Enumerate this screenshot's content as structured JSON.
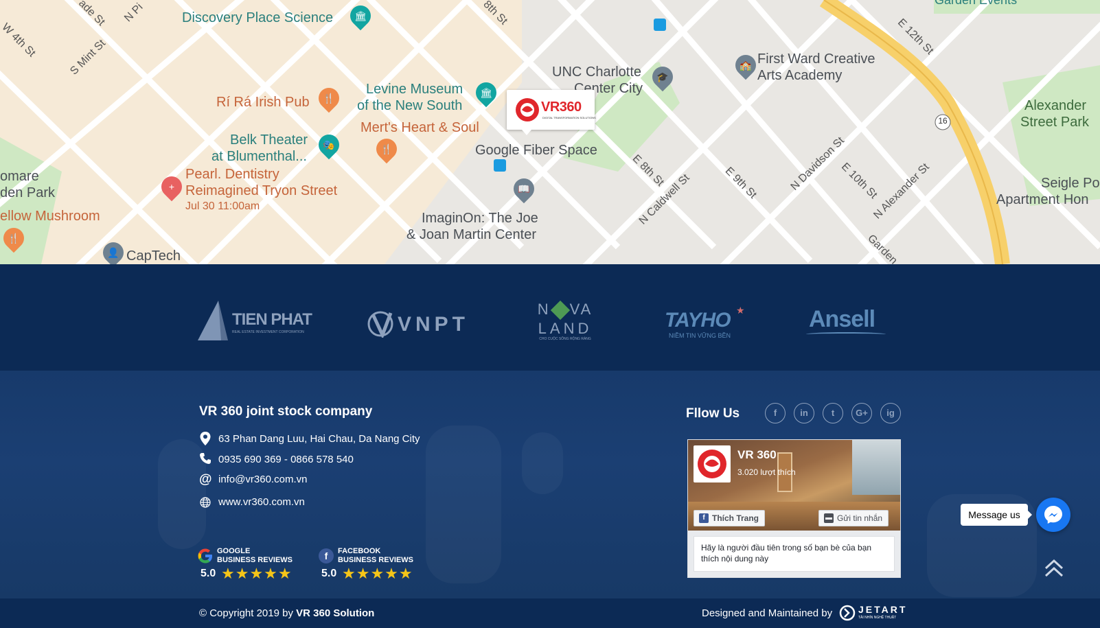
{
  "map": {
    "labels": {
      "discovery": "Discovery Place Science",
      "rira": "Rí Rá Irish Pub",
      "levine1": "Levine Museum",
      "levine2": "of the New South",
      "merts": "Mert's Heart & Soul",
      "unc1": "UNC Charlotte",
      "unc2": "Center City",
      "firstward1": "First Ward Creative",
      "firstward2": "Arts Academy",
      "alexander1": "Alexander",
      "alexander2": "Street Park",
      "belk1": "Belk Theater",
      "belk2": "at Blumenthal...",
      "pearl1": "Pearl. Dentistry",
      "pearl2": "Reimagined Tryon Street",
      "pearl_date": "Jul 30 11:00am",
      "fiber": "Google Fiber Space",
      "imaginon1": "ImaginOn: The Joe",
      "imaginon2": "& Joan Martin Center",
      "captech": "CapTech",
      "yellow": "ellow Mushroom",
      "romare1": "omare",
      "romare2": "den Park",
      "seigle1": "Seigle Po",
      "seigle2": "Apartment Hon",
      "garden_events": "Garden Events",
      "route16": "16"
    },
    "streets": {
      "w4th": "W 4th St",
      "smint": "S Mint St",
      "ade": "ade St",
      "npi": "N Pi",
      "e8th_top": "8th St",
      "e12th": "E 12th St",
      "e8th": "E 8th St",
      "ncaldwell": "N Caldwell St",
      "e9th": "E 9th St",
      "ndavidson": "N Davidson St",
      "e10th": "E 10th St",
      "nalexander": "N Alexander St",
      "garden": "Garden"
    },
    "marker_brand": "VR360",
    "marker_tagline": "DIGITAL TRANSFORMATION SOLUTIONS"
  },
  "partners": [
    {
      "name": "TIEN PHAT",
      "sub": "REAL ESTATE INVESTMENT CORPORATION"
    },
    {
      "name": "VNPT"
    },
    {
      "name1": "N",
      "name2": "VA",
      "name3": "LAND",
      "sub": "CHO CUỘC SỐNG RỘNG RÀNG"
    },
    {
      "name": "TAYHO",
      "sub": "NIỀM TIN VỮNG BỀN"
    },
    {
      "name": "Ansell"
    }
  ],
  "company": {
    "title": "VR 360 joint stock company",
    "address": "63 Phan Dang Luu, Hai Chau, Da Nang City",
    "phone": "0935 690 369 - 0866 578 540",
    "email": "info@vr360.com.vn",
    "website": "www.vr360.com.vn"
  },
  "reviews": [
    {
      "brand1": "GOOGLE",
      "brand2": "BUSINESS REVIEWS",
      "score": "5.0",
      "stars": "★★★★★"
    },
    {
      "brand1": "FACEBOOK",
      "brand2": "BUSINESS REVIEWS",
      "score": "5.0",
      "stars": "★★★★★"
    }
  ],
  "follow": {
    "title": "Fllow Us",
    "social": [
      "f",
      "in",
      "t",
      "G+",
      "ig"
    ]
  },
  "facebook": {
    "page_name": "VR 360",
    "likes": "3.020 lượt thích",
    "like_button": "Thích Trang",
    "message_button": "Gửi tin nhắn",
    "body": "Hãy là người đầu tiên trong số bạn bè của bạn thích nội dung này"
  },
  "messenger": {
    "label": "Message us"
  },
  "bottom": {
    "copyright_prefix": "© Copyright 2019 by ",
    "copyright_brand": "VR 360 Solution",
    "designed": "Designed and Maintained by",
    "designer": "JETART",
    "designer_sub": "TẢI NHÍN NGHỆ THUẬT"
  },
  "colors": {
    "navy": "#0c2a55",
    "footer": "#1b3f73",
    "accent_red": "#e0262b",
    "messenger": "#1877f2",
    "star": "#f5c518"
  }
}
